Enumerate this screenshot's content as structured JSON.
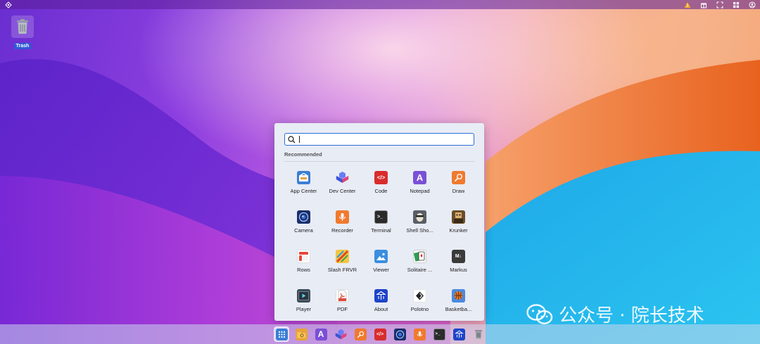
{
  "topbar": {
    "left_icon": "app-logo-icon",
    "right_icons": [
      "warning-icon",
      "gift-icon",
      "fullscreen-icon",
      "grid-icon",
      "user-icon"
    ],
    "warning_color": "#f5a623"
  },
  "desktop": {
    "icons": [
      {
        "label": "Trash",
        "icon": "trash-icon"
      }
    ]
  },
  "launcher": {
    "search": {
      "value": "",
      "placeholder": ""
    },
    "section_title": "Recommended",
    "apps": [
      {
        "label": "App Center",
        "icon": "app-center-icon",
        "color": "#3b7fd6"
      },
      {
        "label": "Dev Center",
        "icon": "dev-center-icon",
        "color": "#4a6cf0"
      },
      {
        "label": "Code",
        "icon": "code-icon",
        "color": "#d92c2c"
      },
      {
        "label": "Notepad",
        "icon": "notepad-icon",
        "color": "#7a4fd6"
      },
      {
        "label": "Draw",
        "icon": "draw-icon",
        "color": "#f07a2e"
      },
      {
        "label": "Camera",
        "icon": "camera-icon",
        "color": "#1b2f6b"
      },
      {
        "label": "Recorder",
        "icon": "recorder-icon",
        "color": "#f07a2e"
      },
      {
        "label": "Terminal",
        "icon": "terminal-icon",
        "color": "#2b2b2b"
      },
      {
        "label": "Shell Sho...",
        "icon": "shell-shockers-icon",
        "color": "#4a4a4a"
      },
      {
        "label": "Krunker",
        "icon": "krunker-icon",
        "color": "#8a6a3a"
      },
      {
        "label": "Rows",
        "icon": "rows-icon",
        "color": "#e8453c"
      },
      {
        "label": "Slash FRVR",
        "icon": "slash-frvr-icon",
        "color": "#f0b428"
      },
      {
        "label": "Viewer",
        "icon": "viewer-icon",
        "color": "#3b8ee0"
      },
      {
        "label": "Solitaire ...",
        "icon": "solitaire-icon",
        "color": "#2e9e4f"
      },
      {
        "label": "Markus",
        "icon": "markus-icon",
        "color": "#3a3a3a"
      },
      {
        "label": "Player",
        "icon": "player-icon",
        "color": "#3a4a5a"
      },
      {
        "label": "PDF",
        "icon": "pdf-icon",
        "color": "#e04a3a"
      },
      {
        "label": "About",
        "icon": "about-icon",
        "color": "#1e44c8"
      },
      {
        "label": "Polotno",
        "icon": "polotno-icon",
        "color": "#222222"
      },
      {
        "label": "Basketba...",
        "icon": "basketball-icon",
        "color": "#e07a2e"
      }
    ]
  },
  "dock": {
    "items": [
      {
        "icon": "launcher-grid-icon",
        "color": "#3b7fd6",
        "active": true
      },
      {
        "icon": "file-manager-icon",
        "color": "#e8a33a"
      },
      {
        "icon": "notepad-icon",
        "color": "#7a4fd6"
      },
      {
        "icon": "dev-center-icon",
        "color": "#4a6cf0"
      },
      {
        "icon": "draw-icon",
        "color": "#f07a2e"
      },
      {
        "icon": "code-icon",
        "color": "#d92c2c"
      },
      {
        "icon": "camera-icon",
        "color": "#1b2f6b"
      },
      {
        "icon": "recorder-icon",
        "color": "#f07a2e"
      },
      {
        "icon": "terminal-icon",
        "color": "#2b2b2b"
      },
      {
        "icon": "about-icon",
        "color": "#1e44c8"
      },
      {
        "icon": "trash-icon",
        "color": "#8a8a8a"
      }
    ]
  },
  "watermark": {
    "text": "公众号 · 院长技术",
    "icon": "wechat-icon"
  }
}
